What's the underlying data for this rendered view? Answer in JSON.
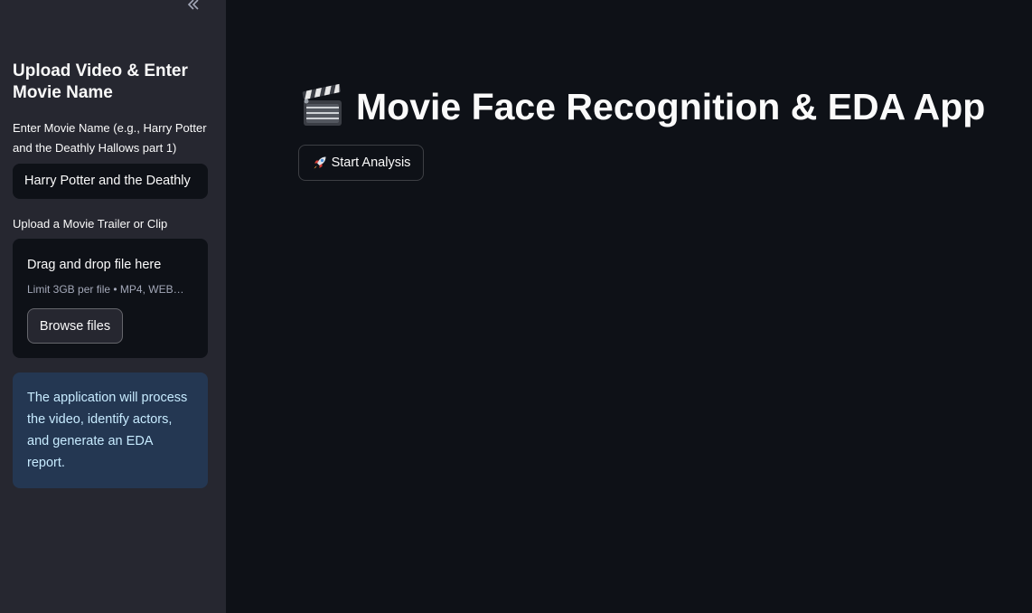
{
  "sidebar": {
    "header": "Upload Video & Enter Movie Name",
    "movie_name": {
      "label": "Enter Movie Name (e.g., Harry Potter and the Deathly Hallows part 1)",
      "value": "Harry Potter and the Deathly"
    },
    "upload": {
      "label": "Upload a Movie Trailer or Clip",
      "drop_text": "Drag and drop file here",
      "limit_text": "Limit 3GB per file • MP4, WEB…",
      "browse_label": "Browse files"
    },
    "info": "The application will process the video, identify actors, and generate an EDA report."
  },
  "main": {
    "title": "Movie Face Recognition & EDA App",
    "start_button": "Start Analysis"
  },
  "icons": {
    "collapse": "double-chevron-left-icon",
    "title": "clapperboard-icon",
    "start": "rocket-icon"
  },
  "colors": {
    "background": "#0e1117",
    "sidebar": "#262730",
    "info_bg": "#243752",
    "info_text": "#c7ebff"
  }
}
